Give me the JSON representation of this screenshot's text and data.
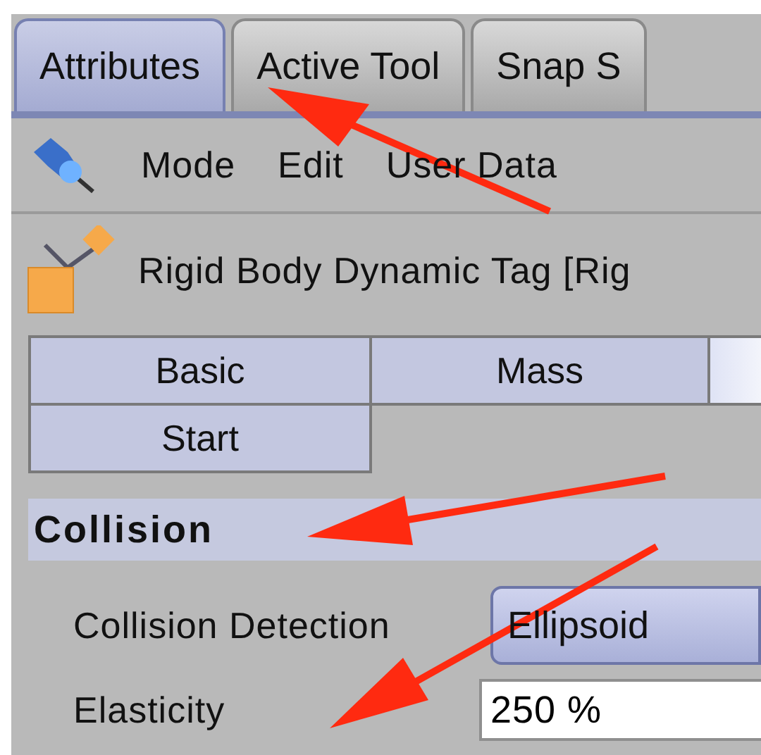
{
  "tabs": [
    {
      "label": "Attributes",
      "selected": true
    },
    {
      "label": "Active Tool",
      "selected": false
    },
    {
      "label": "Snap S",
      "selected": false
    }
  ],
  "menu": [
    "Mode",
    "Edit",
    "User Data"
  ],
  "object_title": "Rigid Body Dynamic Tag [Rig",
  "subtabs": [
    {
      "label": "Basic",
      "selected": false
    },
    {
      "label": "Mass",
      "selected": false
    },
    {
      "selected": true
    },
    {
      "label": "Start",
      "selected": false
    }
  ],
  "section": {
    "title": "Collision"
  },
  "fields": [
    {
      "kind": "dropdown",
      "label": "Collision Detection",
      "value": "Ellipsoid"
    },
    {
      "kind": "input",
      "label": "Elasticity",
      "value": "250 %"
    }
  ]
}
